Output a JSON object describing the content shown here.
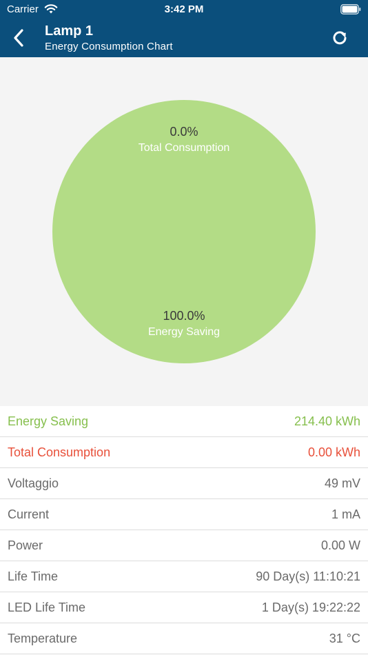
{
  "status_bar": {
    "carrier": "Carrier",
    "time": "3:42 PM"
  },
  "nav": {
    "title": "Lamp 1",
    "subtitle": "Energy Consumption Chart",
    "back_icon": "chevron-left-icon",
    "refresh_icon": "refresh-icon"
  },
  "chart_data": {
    "type": "pie",
    "slices": [
      {
        "label": "Total Consumption",
        "value": 0.0,
        "display": "0.0%",
        "color": "#e8503a"
      },
      {
        "label": "Energy Saving",
        "value": 100.0,
        "display": "100.0%",
        "color": "#b3dc86"
      }
    ]
  },
  "details": [
    {
      "label": "Energy Saving",
      "value": "214.40 kWh",
      "kind": "saving"
    },
    {
      "label": "Total Consumption",
      "value": "0.00 kWh",
      "kind": "consumption"
    },
    {
      "label": "Voltaggio",
      "value": "49 mV",
      "kind": "normal"
    },
    {
      "label": "Current",
      "value": "1 mA",
      "kind": "normal"
    },
    {
      "label": "Power",
      "value": "0.00 W",
      "kind": "normal"
    },
    {
      "label": "Life Time",
      "value": "90 Day(s) 11:10:21",
      "kind": "normal"
    },
    {
      "label": "LED Life Time",
      "value": "1 Day(s) 19:22:22",
      "kind": "normal"
    },
    {
      "label": "Temperature",
      "value": "31 °C",
      "kind": "normal"
    }
  ],
  "colors": {
    "header": "#0b4f7c",
    "saving": "#86bf4d",
    "consumption": "#e8503a",
    "chart_background": "#f4f4f4"
  }
}
